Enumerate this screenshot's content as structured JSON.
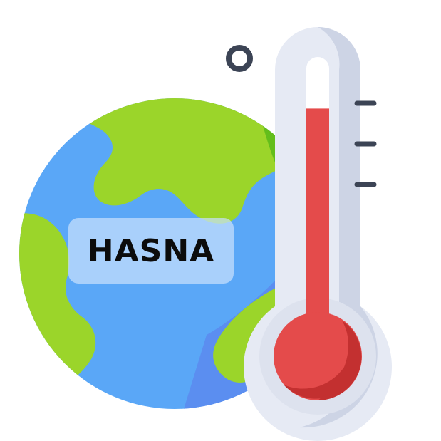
{
  "label": {
    "text": "HASNA"
  },
  "icons": {
    "globe": "globe-icon",
    "thermometer": "thermometer-icon",
    "degree_ring": "degree-ring-icon"
  },
  "colors": {
    "ocean": "#5aa7f7",
    "ocean_shade": "#5b8ef0",
    "land": "#9bd52a",
    "land_shade": "#63be1b",
    "glass": "#e6eaf4",
    "glass_shade": "#cdd4e5",
    "mercury": "#e44b4b",
    "mercury_shade": "#c33030",
    "tick": "#3c4455",
    "label_bg": "#c8e1fc",
    "label_text": "#0c0c0c"
  },
  "thermometer": {
    "level": 0.84
  }
}
